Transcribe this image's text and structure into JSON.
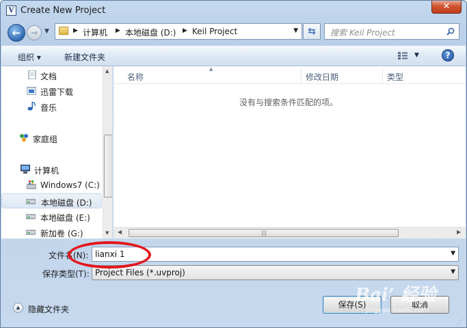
{
  "window": {
    "title": "Create New Project",
    "close_label": "✕"
  },
  "address": {
    "crumbs": [
      "计算机",
      "本地磁盘 (D:)",
      "Keil Project"
    ]
  },
  "search": {
    "placeholder": "搜索 Keil Project"
  },
  "toolbar": {
    "organize": "组织 ▾",
    "new_folder": "新建文件夹",
    "help": "?"
  },
  "nav": {
    "items": [
      {
        "label": "文档",
        "icon": "document-icon"
      },
      {
        "label": "迅雷下载",
        "icon": "download-folder-icon"
      },
      {
        "label": "音乐",
        "icon": "music-icon"
      },
      {
        "label": "家庭组",
        "icon": "homegroup-icon"
      },
      {
        "label": "计算机",
        "icon": "computer-icon"
      },
      {
        "label": "Windows7 (C:)",
        "icon": "system-drive-icon"
      },
      {
        "label": "本地磁盘 (D:)",
        "icon": "drive-icon",
        "selected": true
      },
      {
        "label": "本地磁盘 (E:)",
        "icon": "drive-icon"
      },
      {
        "label": "新加卷 (G:)",
        "icon": "drive-icon"
      }
    ]
  },
  "columns": {
    "name": "名称",
    "modified": "修改日期",
    "type": "类型"
  },
  "content": {
    "empty_message": "没有与搜索条件匹配的项。"
  },
  "form": {
    "filename_label": "文件名(N):",
    "filename_value": "lianxi 1",
    "filetype_label": "保存类型(T):",
    "filetype_value": "Project Files (*.uvproj)"
  },
  "footer": {
    "hide_folders": "隐藏文件夹",
    "save": "保存(S)",
    "cancel": "取消"
  },
  "watermark": {
    "big": "Bai’ 经验",
    "small": "jingyan.baidu.com"
  }
}
